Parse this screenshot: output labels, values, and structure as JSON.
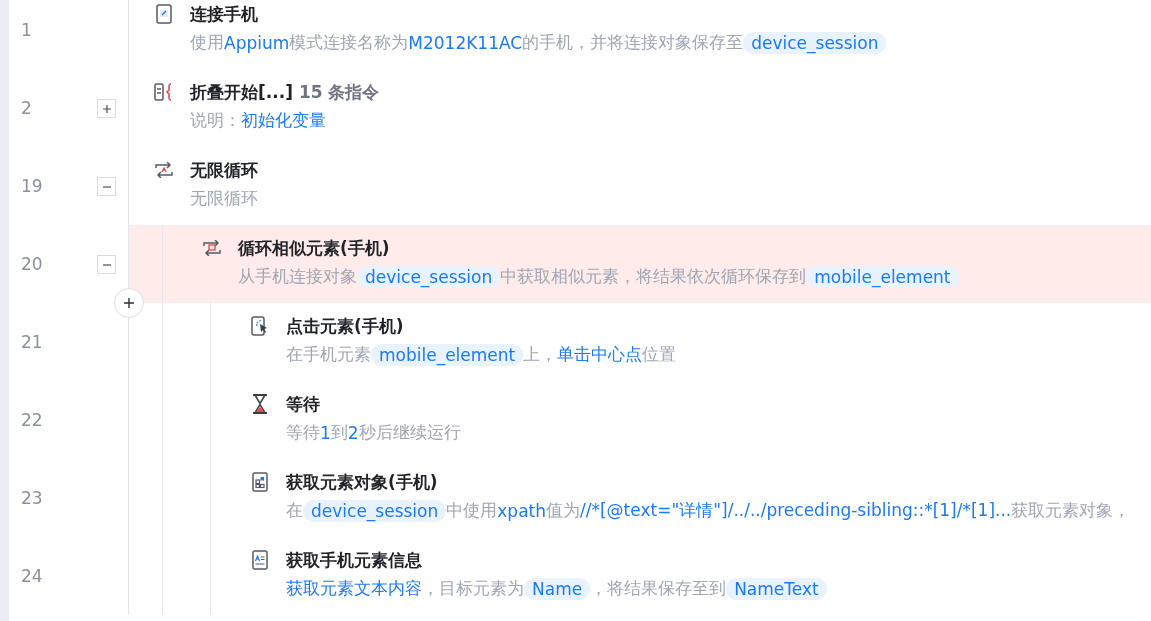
{
  "steps": [
    {
      "line": "1",
      "kind": "phone-link",
      "title": "连接手机",
      "desc": [
        {
          "kind": "plain",
          "text": "使用 "
        },
        {
          "kind": "link",
          "text": "Appium"
        },
        {
          "kind": "plain",
          "text": " 模式连接名称为 "
        },
        {
          "kind": "link",
          "text": "M2012K11AC"
        },
        {
          "kind": "plain",
          "text": " 的手机，并将连接对象保存至"
        },
        {
          "kind": "var",
          "text": "device_session"
        }
      ],
      "selected": false
    },
    {
      "line": "2",
      "kind": "fold",
      "expanded": false,
      "title": "折叠开始[...]",
      "count": "15 条指令",
      "desc": [
        {
          "kind": "plain",
          "text": "说明："
        },
        {
          "kind": "link",
          "text": "初始化变量"
        }
      ],
      "selected": false
    },
    {
      "line": "19",
      "kind": "loop",
      "expanded": true,
      "title": "无限循环",
      "desc": [
        {
          "kind": "plain",
          "text": "无限循环"
        }
      ],
      "selected": false,
      "children": [
        {
          "line": "20",
          "kind": "loop-elements",
          "expanded": true,
          "title": "循环相似元素(手机)",
          "desc": [
            {
              "kind": "plain",
              "text": "从手机连接对象"
            },
            {
              "kind": "var",
              "text": "device_session"
            },
            {
              "kind": "plain",
              "text": "中获取相似元素，将结果依次循环保存到"
            },
            {
              "kind": "var",
              "text": "mobile_element"
            }
          ],
          "selected": true,
          "children": [
            {
              "line": "21",
              "kind": "tap",
              "title": "点击元素(手机)",
              "desc": [
                {
                  "kind": "plain",
                  "text": "在手机元素"
                },
                {
                  "kind": "var",
                  "text": "mobile_element"
                },
                {
                  "kind": "plain",
                  "text": "上，"
                },
                {
                  "kind": "link",
                  "text": "单击中心点"
                },
                {
                  "kind": "plain",
                  "text": "位置"
                }
              ],
              "selected": false
            },
            {
              "line": "22",
              "kind": "hourglass",
              "title": "等待",
              "desc": [
                {
                  "kind": "plain",
                  "text": "等待"
                },
                {
                  "kind": "link",
                  "text": "1"
                },
                {
                  "kind": "plain",
                  "text": "到"
                },
                {
                  "kind": "link",
                  "text": "2"
                },
                {
                  "kind": "plain",
                  "text": "秒后继续运行"
                }
              ],
              "selected": false
            },
            {
              "line": "23",
              "kind": "element-object",
              "title": "获取元素对象(手机)",
              "desc": [
                {
                  "kind": "plain",
                  "text": "在"
                },
                {
                  "kind": "var",
                  "text": "device_session"
                },
                {
                  "kind": "plain",
                  "text": "中使用"
                },
                {
                  "kind": "link",
                  "text": "xpath"
                },
                {
                  "kind": "plain",
                  "text": "值为"
                },
                {
                  "kind": "link",
                  "text": "//*[@text=\"详情\"]/../../preceding-sibling::*[1]/*[1]..."
                },
                {
                  "kind": "plain",
                  "text": "获取元素对象，"
                }
              ],
              "selected": false
            },
            {
              "line": "24",
              "kind": "element-info",
              "title": "获取手机元素信息",
              "desc": [
                {
                  "kind": "link",
                  "text": "获取元素文本内容"
                },
                {
                  "kind": "plain",
                  "text": "，目标元素为"
                },
                {
                  "kind": "var",
                  "text": "Name"
                },
                {
                  "kind": "plain",
                  "text": "，将结果保存至到"
                },
                {
                  "kind": "var",
                  "text": "NameText"
                }
              ],
              "selected": false
            }
          ]
        }
      ]
    }
  ]
}
